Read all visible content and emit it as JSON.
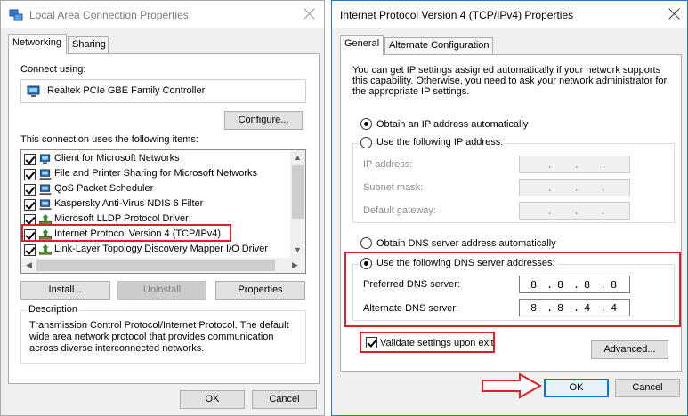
{
  "left_dialog": {
    "title": "Local Area Connection Properties",
    "tabs": [
      "Networking",
      "Sharing"
    ],
    "connect_using_label": "Connect using:",
    "adapter_name": "Realtek PCIe GBE Family Controller",
    "configure_label": "Configure...",
    "items_label": "This connection uses the following items:",
    "items": [
      {
        "label": "Client for Microsoft Networks",
        "checked": true,
        "icon": "network-client-icon"
      },
      {
        "label": "File and Printer Sharing for Microsoft Networks",
        "checked": true,
        "icon": "network-service-icon"
      },
      {
        "label": "QoS Packet Scheduler",
        "checked": true,
        "icon": "network-service-icon"
      },
      {
        "label": "Kaspersky Anti-Virus NDIS 6 Filter",
        "checked": true,
        "icon": "network-service-icon"
      },
      {
        "label": "Microsoft LLDP Protocol Driver",
        "checked": true,
        "icon": "network-protocol-icon"
      },
      {
        "label": "Internet Protocol Version 4 (TCP/IPv4)",
        "checked": true,
        "icon": "network-protocol-icon"
      },
      {
        "label": "Link-Layer Topology Discovery Mapper I/O Driver",
        "checked": true,
        "icon": "network-protocol-icon"
      }
    ],
    "install_label": "Install...",
    "uninstall_label": "Uninstall",
    "properties_label": "Properties",
    "description_title": "Description",
    "description_text": "Transmission Control Protocol/Internet Protocol. The default wide area network protocol that provides communication across diverse interconnected networks.",
    "ok_label": "OK",
    "cancel_label": "Cancel"
  },
  "right_dialog": {
    "title": "Internet Protocol Version 4 (TCP/IPv4) Properties",
    "tabs": [
      "General",
      "Alternate Configuration"
    ],
    "intro_text": "You can get IP settings assigned automatically if your network supports this capability. Otherwise, you need to ask your network administrator for the appropriate IP settings.",
    "obtain_ip_auto": "Obtain an IP address automatically",
    "use_following_ip": "Use the following IP address:",
    "ip_address_label": "IP address:",
    "subnet_mask_label": "Subnet mask:",
    "default_gateway_label": "Default gateway:",
    "obtain_dns_auto": "Obtain DNS server address automatically",
    "use_following_dns": "Use the following DNS server addresses:",
    "preferred_dns_label": "Preferred DNS server:",
    "alternate_dns_label": "Alternate DNS server:",
    "preferred_dns": [
      "8",
      "8",
      "8",
      "8"
    ],
    "alternate_dns": [
      "8",
      "8",
      "4",
      "4"
    ],
    "validate_label": "Validate settings upon exit",
    "validate_checked": true,
    "advanced_label": "Advanced...",
    "ok_label": "OK",
    "cancel_label": "Cancel",
    "ip_selection": "obtain_auto",
    "dns_selection": "use_following"
  },
  "colors": {
    "highlight": "#d9232b",
    "accent": "#0078d7"
  }
}
